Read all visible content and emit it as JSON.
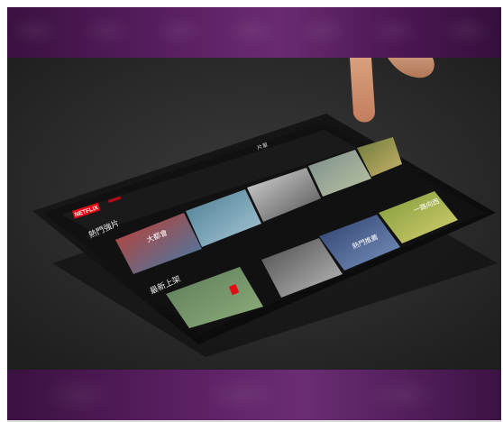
{
  "tablet": {
    "brand_logo": "NETFLIX",
    "top_title": "片單",
    "row1_title": "熱門強片",
    "row2_title": "最新上架",
    "poster_captions": {
      "p1": "大都會",
      "p2": "熱門推薦",
      "p3": "一路向西"
    }
  },
  "colors": {
    "brand_red": "#e50914",
    "band_purple": "#5b1f63",
    "surface": "#2b2b2b"
  },
  "icons": [
    "finger-touch"
  ]
}
